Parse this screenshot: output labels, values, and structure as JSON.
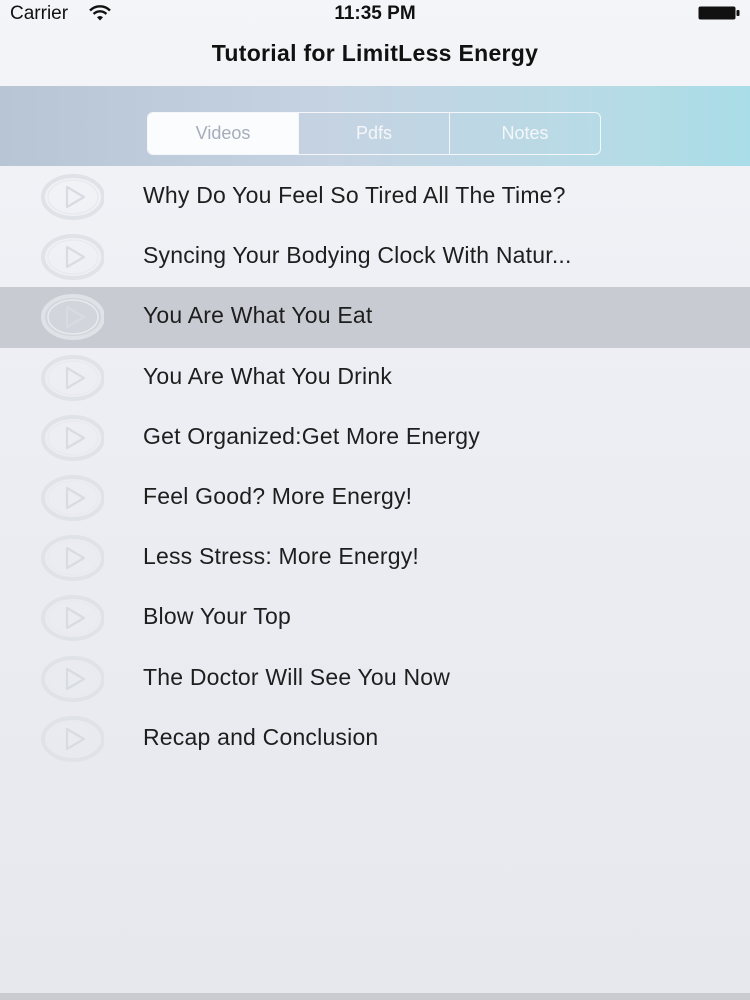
{
  "status_bar": {
    "carrier": "Carrier",
    "time": "11:35 PM"
  },
  "nav": {
    "title": "Tutorial for LimitLess Energy"
  },
  "tabs": [
    {
      "label": "Videos",
      "selected": true
    },
    {
      "label": "Pdfs",
      "selected": false
    },
    {
      "label": "Notes",
      "selected": false
    }
  ],
  "videos": [
    {
      "title": "Why Do You Feel So Tired All The Time?",
      "icon": "play-circle-icon"
    },
    {
      "title": "Syncing Your Bodying Clock With Natur...",
      "icon": "play-circle-icon"
    },
    {
      "title": "You Are What You Eat",
      "icon": "play-circle-icon",
      "highlighted": true
    },
    {
      "title": "You Are What You Drink",
      "icon": "play-circle-icon"
    },
    {
      "title": "Get Organized:Get More Energy",
      "icon": "play-circle-icon"
    },
    {
      "title": "Feel Good? More Energy!",
      "icon": "play-circle-icon"
    },
    {
      "title": "Less Stress: More Energy!",
      "icon": "play-circle-icon"
    },
    {
      "title": "Blow Your Top",
      "icon": "play-circle-icon"
    },
    {
      "title": "The Doctor Will See You Now",
      "icon": "play-circle-icon"
    },
    {
      "title": "Recap and Conclusion",
      "icon": "play-circle-icon"
    }
  ],
  "colors": {
    "highlight_row": "#c8cbd2",
    "segment_bar_start": "#b8c5d5",
    "segment_bar_end": "#a9dde7",
    "selected_tab_text": "#a5adbb"
  }
}
